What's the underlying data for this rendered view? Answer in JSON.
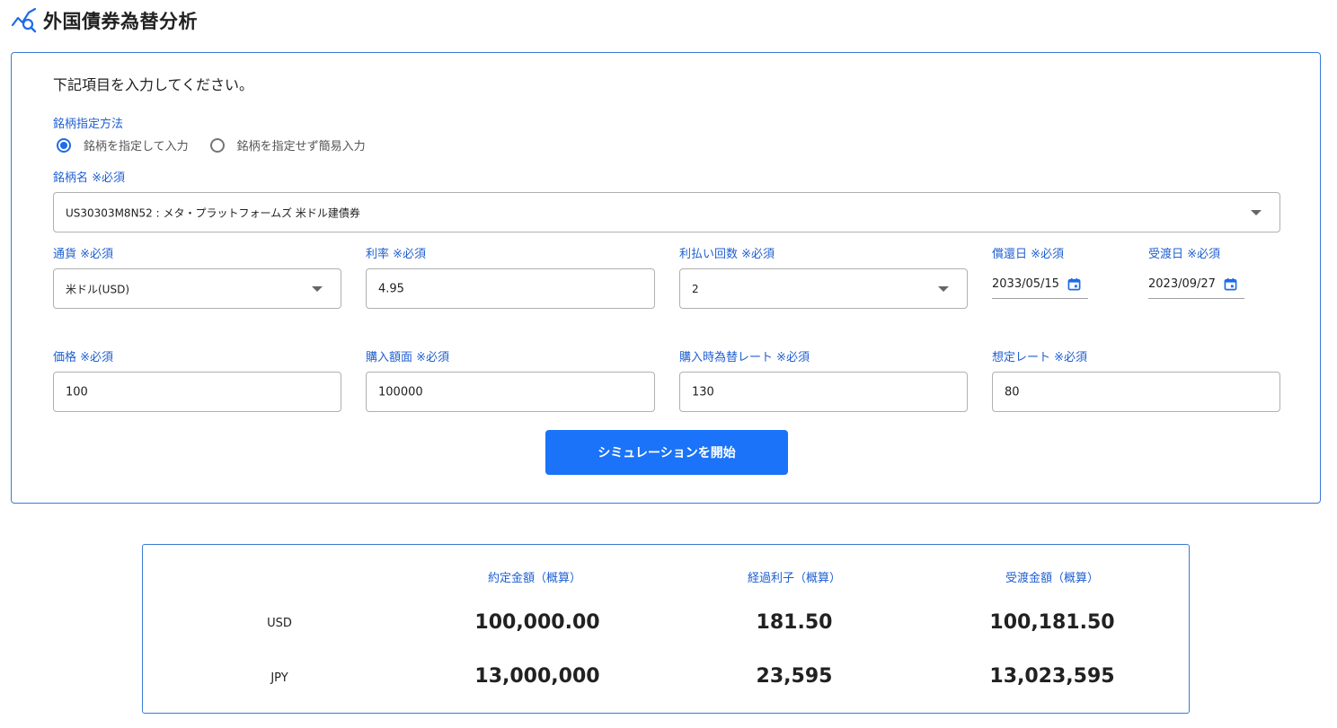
{
  "header": {
    "title": "外国債券為替分析",
    "icon": "chart-search-icon"
  },
  "form": {
    "lead": "下記項目を入力してください。",
    "method": {
      "label": "銘柄指定方法",
      "options": [
        {
          "label": "銘柄を指定して入力",
          "checked": true
        },
        {
          "label": "銘柄を指定せず簡易入力",
          "checked": false
        }
      ]
    },
    "bond_name": {
      "label": "銘柄名 ※必須",
      "value": "US30303M8N52 : メタ・プラットフォームズ 米ドル建債券"
    },
    "currency": {
      "label": "通貨 ※必須",
      "value": "米ドル(USD)"
    },
    "interest_rate": {
      "label": "利率 ※必須",
      "value": "4.95"
    },
    "payment_count": {
      "label": "利払い回数 ※必須",
      "value": "2"
    },
    "redemption_date": {
      "label": "償還日 ※必須",
      "value": "2033/05/15"
    },
    "settlement_date": {
      "label": "受渡日 ※必須",
      "value": "2023/09/27"
    },
    "price": {
      "label": "価格 ※必須",
      "value": "100"
    },
    "face_value": {
      "label": "購入額面 ※必須",
      "value": "100000"
    },
    "purchase_rate": {
      "label": "購入時為替レート ※必須",
      "value": "130"
    },
    "assumed_rate": {
      "label": "想定レート ※必須",
      "value": "80"
    },
    "submit_label": "シミュレーションを開始"
  },
  "results": {
    "columns": [
      "約定金額（概算）",
      "経過利子（概算）",
      "受渡金額（概算）"
    ],
    "rows": [
      {
        "label": "USD",
        "values": [
          "100,000.00",
          "181.50",
          "100,181.50"
        ]
      },
      {
        "label": "JPY",
        "values": [
          "13,000,000",
          "23,595",
          "13,023,595"
        ]
      }
    ]
  },
  "colors": {
    "accent": "#1a73f8",
    "label": "#1f5fd1",
    "border": "#3a7bd5"
  }
}
